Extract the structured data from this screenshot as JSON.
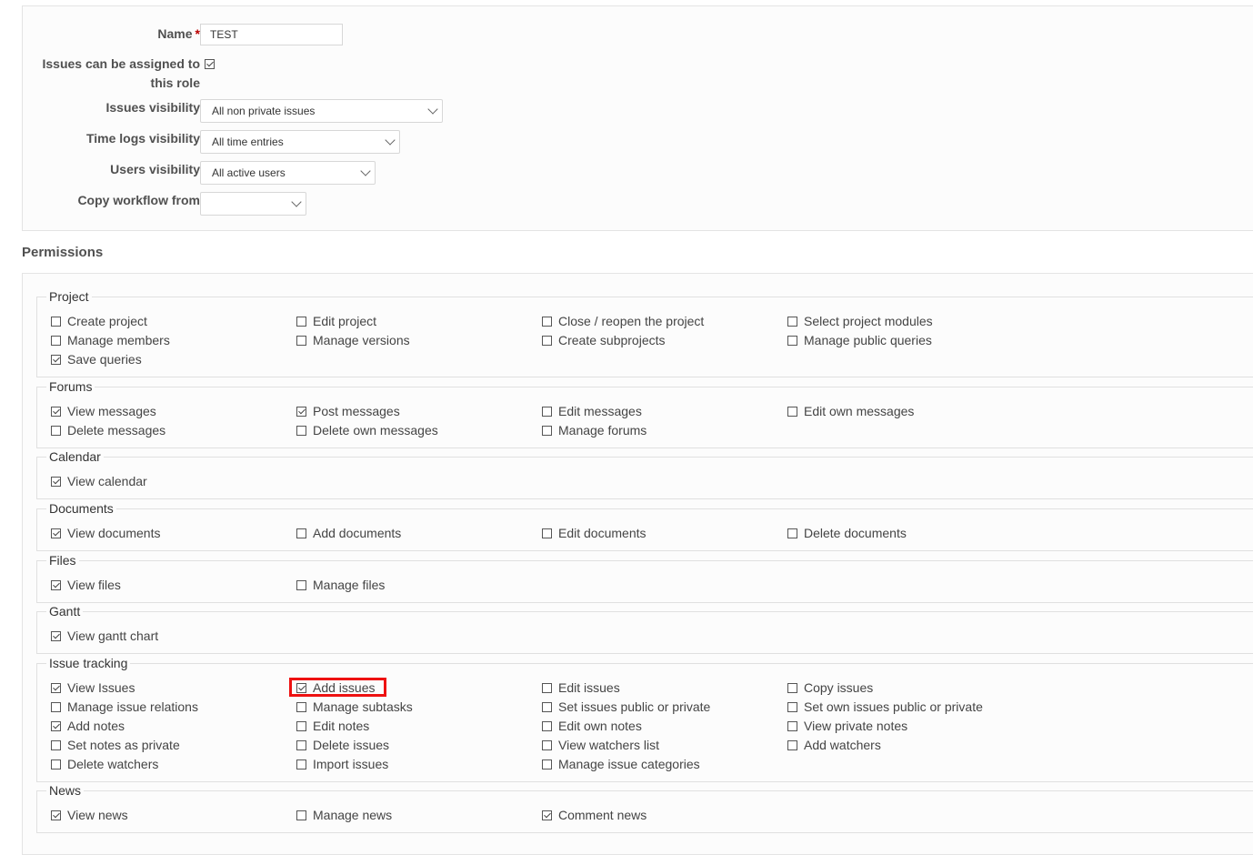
{
  "form": {
    "name_label": "Name",
    "required_mark": "*",
    "name_value": "TEST",
    "assignable_label_line1": "Issues can be assigned to",
    "assignable_label_line2": "this role",
    "assignable_checked": true,
    "issues_visibility_label": "Issues visibility",
    "issues_visibility_value": "All non private issues",
    "time_logs_visibility_label": "Time logs visibility",
    "time_logs_visibility_value": "All time entries",
    "users_visibility_label": "Users visibility",
    "users_visibility_value": "All active users",
    "copy_workflow_label": "Copy workflow from",
    "copy_workflow_value": ""
  },
  "permissions": {
    "title": "Permissions",
    "groups": [
      {
        "name": "Project",
        "items": [
          {
            "label": "Create project",
            "checked": false
          },
          {
            "label": "Edit project",
            "checked": false
          },
          {
            "label": "Close / reopen the project",
            "checked": false
          },
          {
            "label": "Select project modules",
            "checked": false
          },
          {
            "label": "Manage members",
            "checked": false
          },
          {
            "label": "Manage versions",
            "checked": false
          },
          {
            "label": "Create subprojects",
            "checked": false
          },
          {
            "label": "Manage public queries",
            "checked": false
          },
          {
            "label": "Save queries",
            "checked": true
          }
        ]
      },
      {
        "name": "Forums",
        "items": [
          {
            "label": "View messages",
            "checked": true
          },
          {
            "label": "Post messages",
            "checked": true
          },
          {
            "label": "Edit messages",
            "checked": false
          },
          {
            "label": "Edit own messages",
            "checked": false
          },
          {
            "label": "Delete messages",
            "checked": false
          },
          {
            "label": "Delete own messages",
            "checked": false
          },
          {
            "label": "Manage forums",
            "checked": false
          }
        ]
      },
      {
        "name": "Calendar",
        "items": [
          {
            "label": "View calendar",
            "checked": true
          }
        ]
      },
      {
        "name": "Documents",
        "items": [
          {
            "label": "View documents",
            "checked": true
          },
          {
            "label": "Add documents",
            "checked": false
          },
          {
            "label": "Edit documents",
            "checked": false
          },
          {
            "label": "Delete documents",
            "checked": false
          }
        ]
      },
      {
        "name": "Files",
        "items": [
          {
            "label": "View files",
            "checked": true
          },
          {
            "label": "Manage files",
            "checked": false
          }
        ]
      },
      {
        "name": "Gantt",
        "items": [
          {
            "label": "View gantt chart",
            "checked": true
          }
        ]
      },
      {
        "name": "Issue tracking",
        "items": [
          {
            "label": "View Issues",
            "checked": true
          },
          {
            "label": "Add issues",
            "checked": true
          },
          {
            "label": "Edit issues",
            "checked": false
          },
          {
            "label": "Copy issues",
            "checked": false
          },
          {
            "label": "Manage issue relations",
            "checked": false
          },
          {
            "label": "Manage subtasks",
            "checked": false
          },
          {
            "label": "Set issues public or private",
            "checked": false
          },
          {
            "label": "Set own issues public or private",
            "checked": false
          },
          {
            "label": "Add notes",
            "checked": true
          },
          {
            "label": "Edit notes",
            "checked": false
          },
          {
            "label": "Edit own notes",
            "checked": false
          },
          {
            "label": "View private notes",
            "checked": false
          },
          {
            "label": "Set notes as private",
            "checked": false
          },
          {
            "label": "Delete issues",
            "checked": false
          },
          {
            "label": "View watchers list",
            "checked": false
          },
          {
            "label": "Add watchers",
            "checked": false
          },
          {
            "label": "Delete watchers",
            "checked": false
          },
          {
            "label": "Import issues",
            "checked": false
          },
          {
            "label": "Manage issue categories",
            "checked": false
          }
        ]
      },
      {
        "name": "News",
        "items": [
          {
            "label": "View news",
            "checked": true
          },
          {
            "label": "Manage news",
            "checked": false
          },
          {
            "label": "Comment news",
            "checked": true
          }
        ]
      }
    ]
  },
  "highlight_color": "#ee1111"
}
